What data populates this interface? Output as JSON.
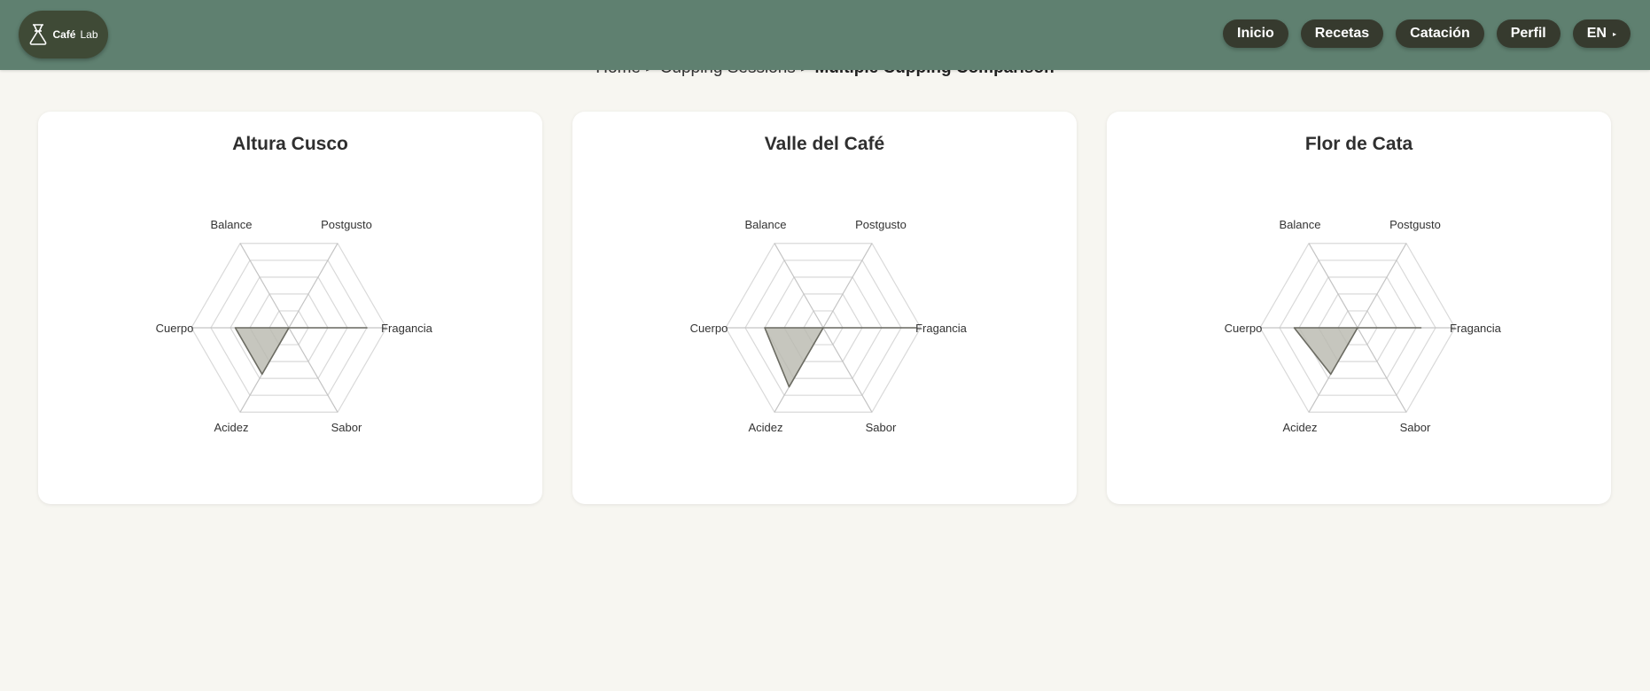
{
  "header": {
    "logo": {
      "name": "Café",
      "suffix": "Lab",
      "icon": "chemex-icon"
    },
    "nav": [
      {
        "label": "Inicio",
        "name": "nav-inicio-button"
      },
      {
        "label": "Recetas",
        "name": "nav-recetas-button"
      },
      {
        "label": "Catación",
        "name": "nav-catacion-button"
      },
      {
        "label": "Perfil",
        "name": "nav-perfil-button"
      }
    ],
    "language": {
      "label": "EN",
      "caret": "▸"
    }
  },
  "breadcrumb": {
    "home": "Home",
    "sep": ">",
    "section": "Cupping Sessions",
    "current": "Multiple Cupping Comparison"
  },
  "colors": {
    "header_bg": "#5f8070",
    "nav_bg": "#363a2e",
    "page_bg": "#f7f6f1",
    "radar_fill": "#b8b8ae",
    "radar_stroke": "#6b6b62",
    "grid": "#d9d9d9"
  },
  "chart_data": [
    {
      "type": "radar",
      "title": "Altura Cusco",
      "axes": [
        "Fragancia",
        "Sabor",
        "Acidez",
        "Cuerpo",
        "Balance",
        "Postgusto"
      ],
      "values": [
        8,
        0,
        5.5,
        5.5,
        0,
        0
      ],
      "range": [
        0,
        10
      ]
    },
    {
      "type": "radar",
      "title": "Valle del Café",
      "axes": [
        "Fragancia",
        "Sabor",
        "Acidez",
        "Cuerpo",
        "Balance",
        "Postgusto"
      ],
      "values": [
        9.5,
        0,
        7,
        6,
        0,
        0
      ],
      "range": [
        0,
        10
      ]
    },
    {
      "type": "radar",
      "title": "Flor de Cata",
      "axes": [
        "Fragancia",
        "Sabor",
        "Acidez",
        "Cuerpo",
        "Balance",
        "Postgusto"
      ],
      "values": [
        6.5,
        0,
        5.5,
        6.5,
        0,
        0
      ],
      "range": [
        0,
        10
      ]
    }
  ]
}
